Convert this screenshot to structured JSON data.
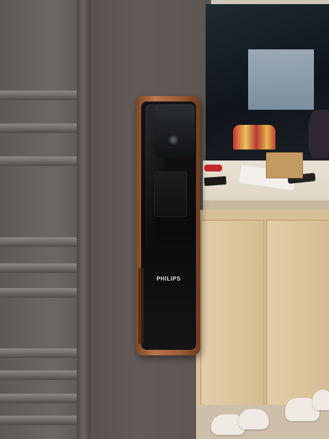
{
  "scene": {
    "description_type": "photo",
    "lock": {
      "brand": "PHILIPS",
      "finish_color": "#a2633b",
      "face_color": "#0d0c0e"
    },
    "door_color": "#5f5854",
    "cabinet_color": "#d8c09a"
  }
}
